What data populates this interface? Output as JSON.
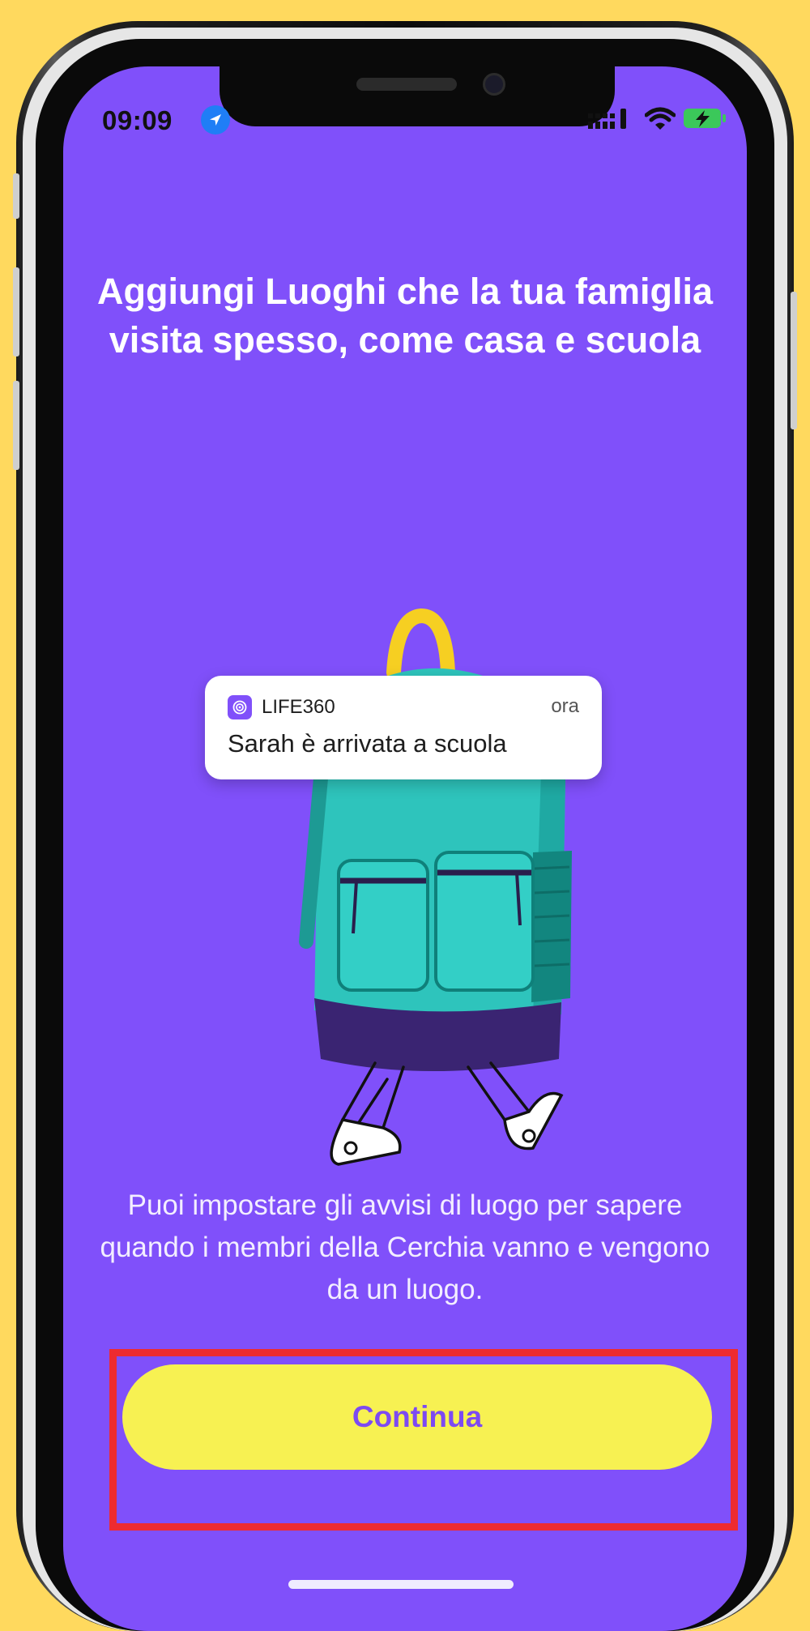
{
  "colors": {
    "background": "#ffd95e",
    "screen": "#8050fa",
    "cta": "#f7f152",
    "cta_text": "#7d4af2",
    "highlight": "#ee2b30"
  },
  "status_bar": {
    "time": "09:09",
    "icons": [
      "location-arrow-icon",
      "signal-icon",
      "wifi-icon",
      "battery-charging-icon"
    ]
  },
  "onboarding": {
    "heading": "Aggiungi Luoghi che la tua famiglia visita spesso, come casa e scuola",
    "description": "Puoi impostare gli avvisi di luogo per sapere quando i membri della Cerchia vanno e vengono da un luogo."
  },
  "notification": {
    "app_name": "LIFE360",
    "time": "ora",
    "message": "Sarah è arrivata a scuola"
  },
  "cta": {
    "label": "Continua"
  }
}
